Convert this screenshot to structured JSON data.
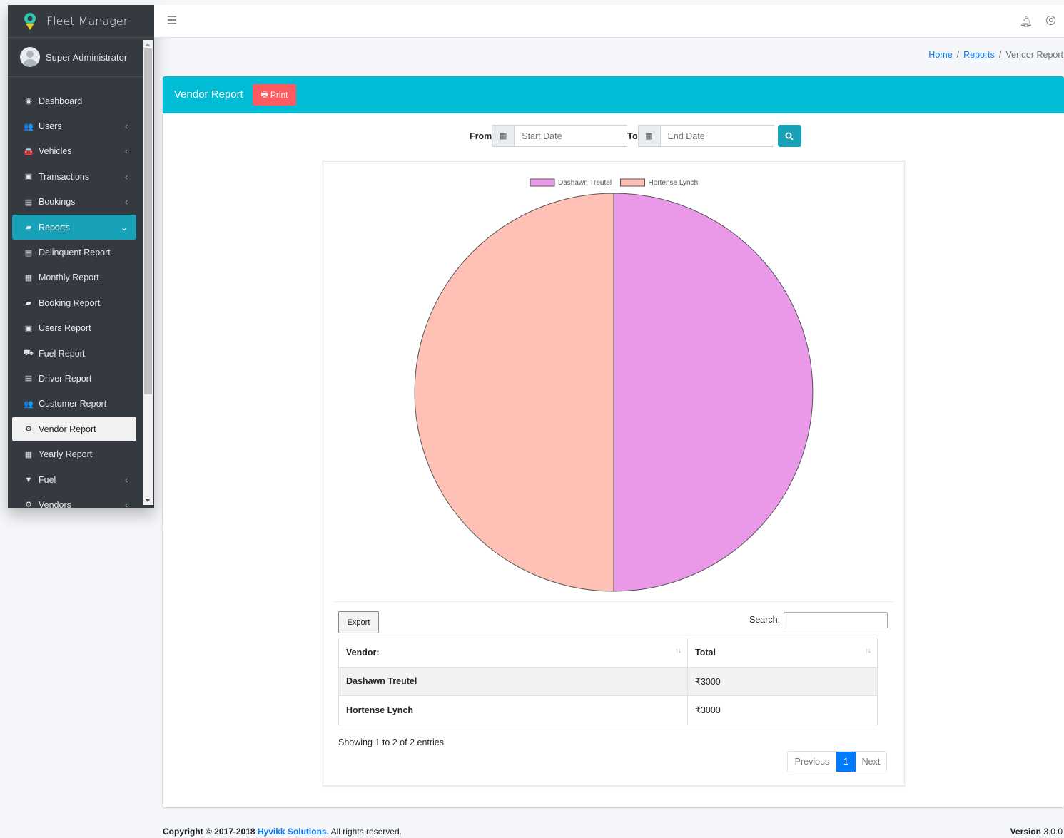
{
  "brand": {
    "title": "Fleet Manager"
  },
  "user": {
    "name": "Super Administrator"
  },
  "sidebar": {
    "items": [
      {
        "label": "Dashboard",
        "icon": "dashboard-icon",
        "glyph": "◉",
        "chev": ""
      },
      {
        "label": "Users",
        "icon": "users-icon",
        "glyph": "👥",
        "chev": "‹"
      },
      {
        "label": "Vehicles",
        "icon": "car-icon",
        "glyph": "🚘",
        "chev": "‹"
      },
      {
        "label": "Transactions",
        "icon": "money-icon",
        "glyph": "▣",
        "chev": "‹"
      },
      {
        "label": "Bookings",
        "icon": "address-card-icon",
        "glyph": "▤",
        "chev": "‹"
      },
      {
        "label": "Reports",
        "icon": "book-icon",
        "glyph": "▰",
        "chev": "⌄"
      },
      {
        "label": "Delinquent Report",
        "icon": "file-icon",
        "glyph": "▤",
        "chev": ""
      },
      {
        "label": "Monthly Report",
        "icon": "calendar-icon",
        "glyph": "▦",
        "chev": ""
      },
      {
        "label": "Booking Report",
        "icon": "book-icon",
        "glyph": "▰",
        "chev": ""
      },
      {
        "label": "Users Report",
        "icon": "contact-book-icon",
        "glyph": "▣",
        "chev": ""
      },
      {
        "label": "Fuel Report",
        "icon": "truck-icon",
        "glyph": "⛟",
        "chev": ""
      },
      {
        "label": "Driver Report",
        "icon": "id-card-icon",
        "glyph": "▤",
        "chev": ""
      },
      {
        "label": "Customer Report",
        "icon": "users-icon",
        "glyph": "👥",
        "chev": ""
      },
      {
        "label": "Vendor Report",
        "icon": "cogs-icon",
        "glyph": "⚙",
        "chev": ""
      },
      {
        "label": "Yearly Report",
        "icon": "calendar-icon",
        "glyph": "▦",
        "chev": ""
      },
      {
        "label": "Fuel",
        "icon": "filter-icon",
        "glyph": "▼",
        "chev": "‹"
      },
      {
        "label": "Vendors",
        "icon": "cogs-icon",
        "glyph": "⚙",
        "chev": "‹"
      }
    ]
  },
  "breadcrumb": {
    "home": "Home",
    "reports": "Reports",
    "current": "Vendor Report",
    "sep": "/"
  },
  "card": {
    "title": "Vendor Report",
    "print_label": "Print"
  },
  "filter": {
    "from_label": "From",
    "to_label": "To",
    "start_placeholder": "Start Date",
    "end_placeholder": "End Date"
  },
  "chart_data": {
    "type": "pie",
    "labels": [
      "Dashawn Treutel",
      "Hortense Lynch"
    ],
    "values": [
      3000,
      3000
    ],
    "colors": [
      "#ea99e8",
      "#ffc0b5"
    ],
    "legend": "top"
  },
  "table": {
    "export_label": "Export",
    "search_label": "Search:",
    "headers": [
      "Vendor:",
      "Total"
    ],
    "rows": [
      {
        "vendor": "Dashawn Treutel",
        "total": "₹3000"
      },
      {
        "vendor": "Hortense Lynch",
        "total": "₹3000"
      }
    ],
    "info": "Showing 1 to 2 of 2 entries",
    "pager": {
      "prev": "Previous",
      "page": "1",
      "next": "Next"
    }
  },
  "footer": {
    "copyright_prefix": "Copyright © 2017-2018",
    "company": "Hyvikk Solutions.",
    "suffix": "All rights reserved.",
    "version_label": "Version",
    "version": "3.0.0"
  }
}
